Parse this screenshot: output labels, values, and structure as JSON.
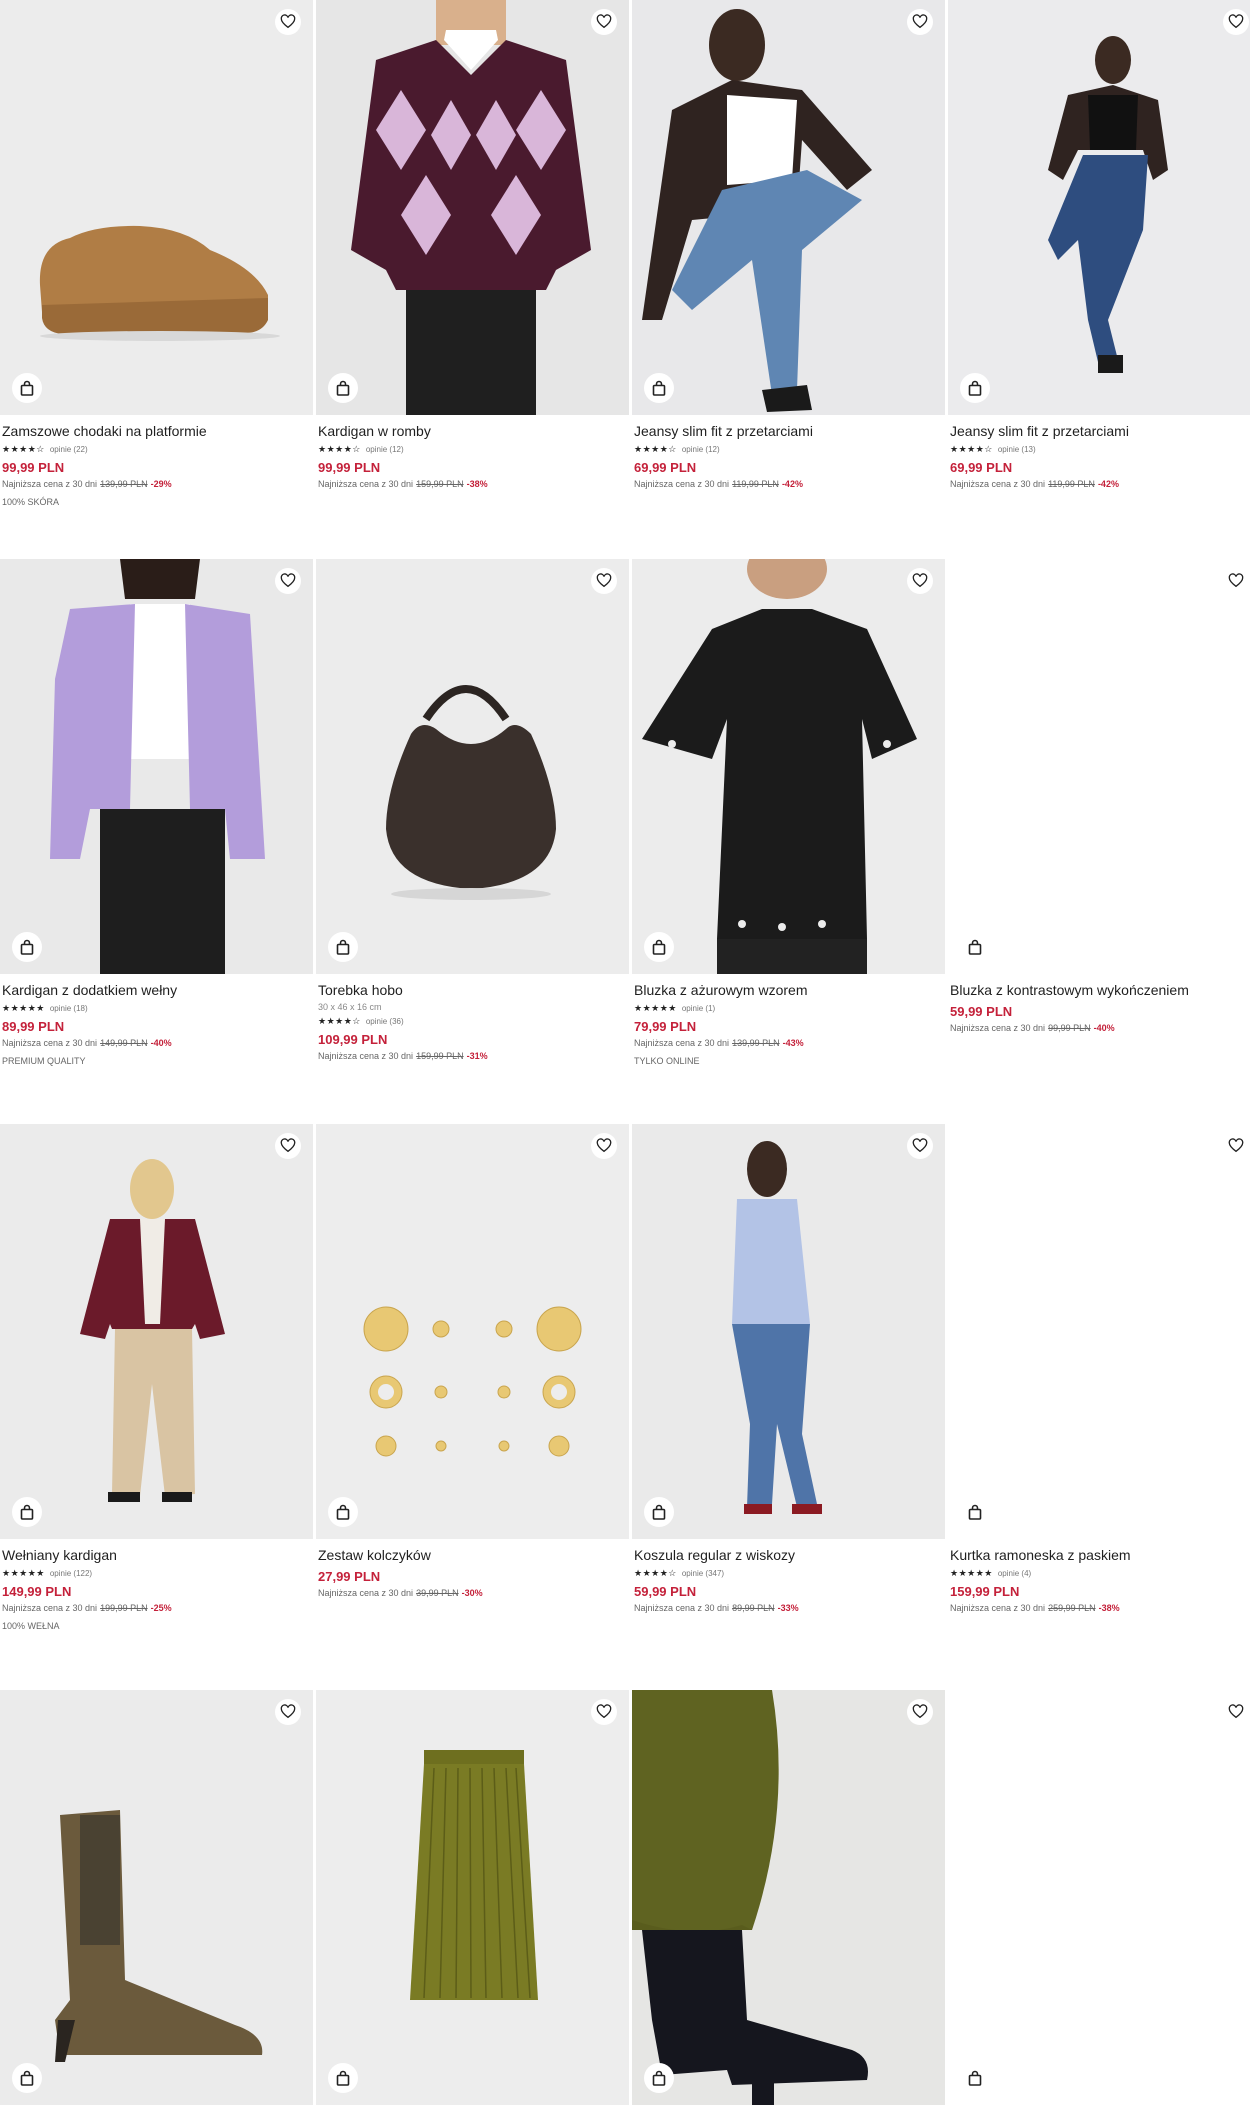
{
  "products": [
    {
      "name": "Zamszowe chodaki na platformie",
      "stars": "★★★★☆",
      "reviews": "opinie (22)",
      "price": "99,99 PLN",
      "lowest_label": "Najniższa cena z 30 dni",
      "old_price": "139,99 PLN",
      "discount": "-29%",
      "badge": "100% SKÓRA",
      "image": "suede-platform-clog-image"
    },
    {
      "name": "Kardigan w romby",
      "stars": "★★★★☆",
      "reviews": "opinie (12)",
      "price": "99,99 PLN",
      "lowest_label": "Najniższa cena z 30 dni",
      "old_price": "159,99 PLN",
      "discount": "-38%",
      "image": "argyle-cardigan-image"
    },
    {
      "name": "Jeansy slim fit z przetarciami",
      "stars": "★★★★☆",
      "reviews": "opinie (12)",
      "price": "69,99 PLN",
      "lowest_label": "Najniższa cena z 30 dni",
      "old_price": "119,99 PLN",
      "discount": "-42%",
      "image": "slim-jeans-image"
    },
    {
      "name": "Jeansy slim fit z przetarciami",
      "stars": "★★★★☆",
      "reviews": "opinie (13)",
      "price": "69,99 PLN",
      "lowest_label": "Najniższa cena z 30 dni",
      "old_price": "119,99 PLN",
      "discount": "-42%",
      "image": "slim-jeans-full-image"
    },
    {
      "name": "Kardigan z dodatkiem wełny",
      "stars": "★★★★★",
      "reviews": "opinie (18)",
      "price": "89,99 PLN",
      "lowest_label": "Najniższa cena z 30 dni",
      "old_price": "149,99 PLN",
      "discount": "-40%",
      "badge": "PREMIUM QUALITY",
      "image": "lilac-cardigan-image"
    },
    {
      "name": "Torebka hobo",
      "dims": "30 x 46 x 16 cm",
      "stars": "★★★★☆",
      "reviews": "opinie (36)",
      "price": "109,99 PLN",
      "lowest_label": "Najniższa cena z 30 dni",
      "old_price": "159,99 PLN",
      "discount": "-31%",
      "image": "hobo-bag-image"
    },
    {
      "name": "Bluzka z ażurowym wzorem",
      "stars": "★★★★★",
      "reviews": "opinie (1)",
      "price": "79,99 PLN",
      "lowest_label": "Najniższa cena z 30 dni",
      "old_price": "139,99 PLN",
      "discount": "-43%",
      "badge": "TYLKO ONLINE",
      "image": "openwork-blouse-image"
    },
    {
      "name": "Bluzka z kontrastowym wykończeniem",
      "price": "59,99 PLN",
      "lowest_label": "Najniższa cena z 30 dni",
      "old_price": "99,99 PLN",
      "discount": "-40%",
      "image": "blank"
    },
    {
      "name": "Wełniany kardigan",
      "stars": "★★★★★",
      "reviews": "opinie (122)",
      "price": "149,99 PLN",
      "lowest_label": "Najniższa cena z 30 dni",
      "old_price": "199,99 PLN",
      "discount": "-25%",
      "badge": "100% WEŁNA",
      "image": "wool-cardigan-image"
    },
    {
      "name": "Zestaw kolczyków",
      "price": "27,99 PLN",
      "lowest_label": "Najniższa cena z 30 dni",
      "old_price": "39,99 PLN",
      "discount": "-30%",
      "image": "earrings-set-image"
    },
    {
      "name": "Koszula regular z wiskozy",
      "stars": "★★★★☆",
      "reviews": "opinie (347)",
      "price": "59,99 PLN",
      "lowest_label": "Najniższa cena z 30 dni",
      "old_price": "89,99 PLN",
      "discount": "-33%",
      "image": "viscose-shirt-image"
    },
    {
      "name": "Kurtka ramoneska z paskiem",
      "stars": "★★★★★",
      "reviews": "opinie (4)",
      "price": "159,99 PLN",
      "lowest_label": "Najniższa cena z 30 dni",
      "old_price": "259,99 PLN",
      "discount": "-38%",
      "image": "blank"
    },
    {
      "image": "suede-ankle-boot-image"
    },
    {
      "image": "pleated-skirt-image"
    },
    {
      "image": "satin-skirt-boots-image"
    },
    {
      "image": "blank"
    }
  ],
  "colors": {
    "price": "#c4213a",
    "placeholder": "#ececec"
  },
  "icons": {
    "favorite": "heart-icon",
    "add_to_cart": "shopping-bag-icon"
  }
}
